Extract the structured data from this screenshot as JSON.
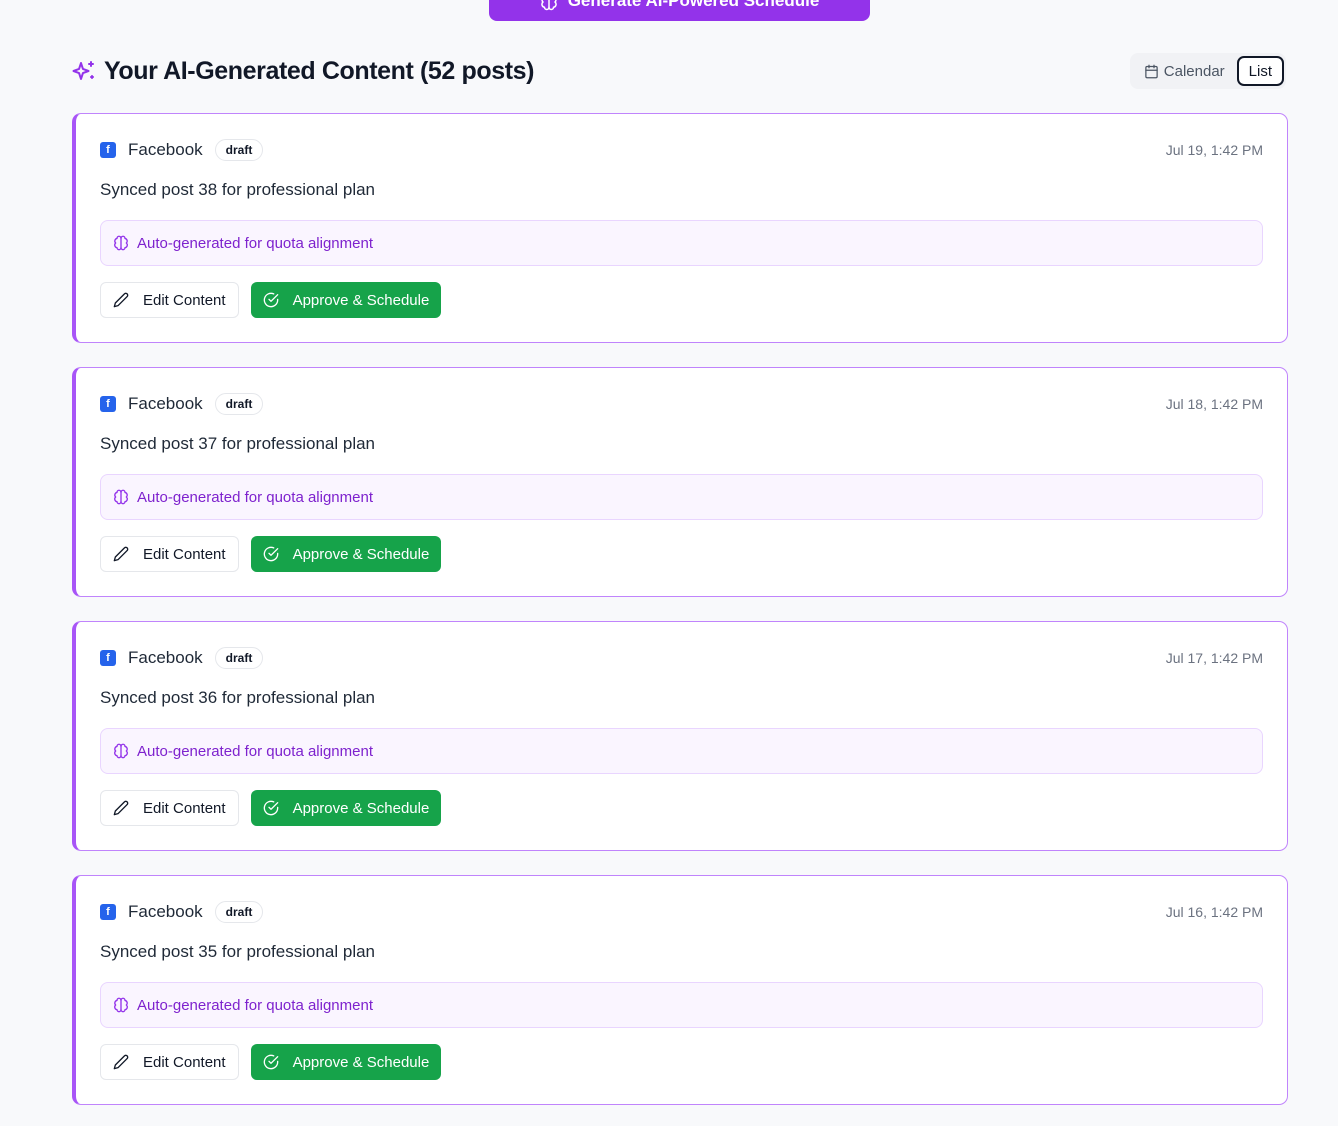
{
  "generate_button": {
    "label": "Generate AI-Powered Schedule",
    "icon": "brain-icon"
  },
  "header": {
    "title": "Your AI-Generated Content (52 posts)",
    "icon": "sparkles-icon"
  },
  "view_toggle": {
    "calendar_label": "Calendar",
    "list_label": "List",
    "active": "List"
  },
  "colors": {
    "accent": "#9333ea",
    "card_border": "#a855f7",
    "approve": "#16a34a",
    "facebook": "#2563eb"
  },
  "posts": [
    {
      "platform": "Facebook",
      "platform_icon": "f",
      "status": "draft",
      "time": "Jul 19, 1:42 PM",
      "text": "Synced post 38 for professional plan",
      "ai_note": "Auto-generated for quota alignment",
      "edit_label": "Edit Content",
      "approve_label": "Approve & Schedule"
    },
    {
      "platform": "Facebook",
      "platform_icon": "f",
      "status": "draft",
      "time": "Jul 18, 1:42 PM",
      "text": "Synced post 37 for professional plan",
      "ai_note": "Auto-generated for quota alignment",
      "edit_label": "Edit Content",
      "approve_label": "Approve & Schedule"
    },
    {
      "platform": "Facebook",
      "platform_icon": "f",
      "status": "draft",
      "time": "Jul 17, 1:42 PM",
      "text": "Synced post 36 for professional plan",
      "ai_note": "Auto-generated for quota alignment",
      "edit_label": "Edit Content",
      "approve_label": "Approve & Schedule"
    },
    {
      "platform": "Facebook",
      "platform_icon": "f",
      "status": "draft",
      "time": "Jul 16, 1:42 PM",
      "text": "Synced post 35 for professional plan",
      "ai_note": "Auto-generated for quota alignment",
      "edit_label": "Edit Content",
      "approve_label": "Approve & Schedule"
    }
  ]
}
